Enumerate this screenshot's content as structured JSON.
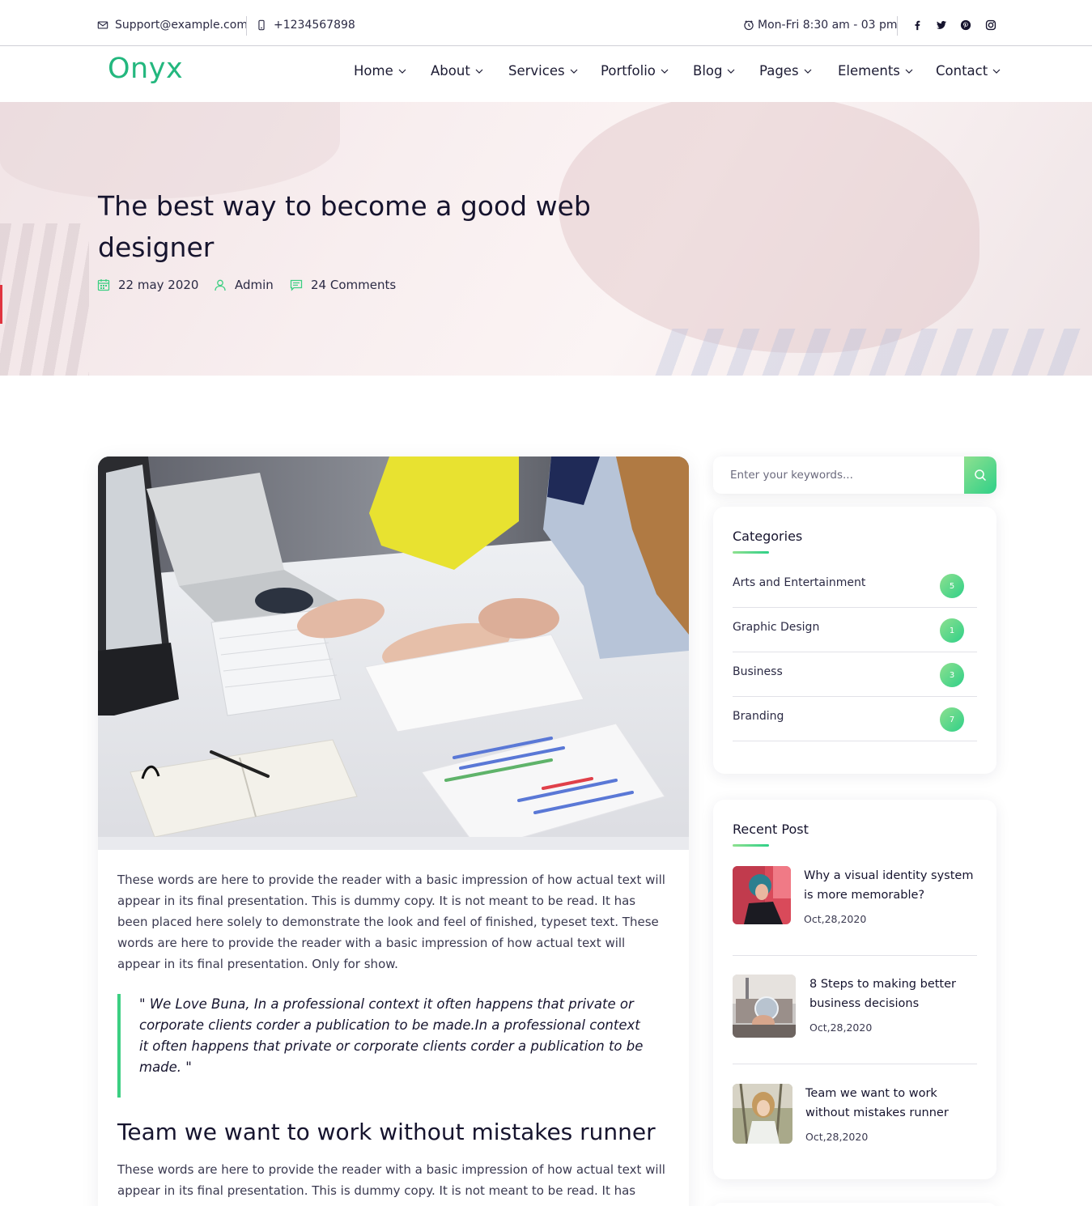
{
  "topbar": {
    "email": "Support@example.com",
    "phone": "+1234567898",
    "hours": "Mon-Fri 8:30 am - 03 pm",
    "social_icons": [
      "facebook-icon",
      "twitter-icon",
      "pinterest-icon",
      "instagram-icon"
    ]
  },
  "nav": {
    "logo": "Onyx",
    "items": [
      {
        "label": "Home"
      },
      {
        "label": "About"
      },
      {
        "label": "Services"
      },
      {
        "label": "Portfolio"
      },
      {
        "label": "Blog"
      },
      {
        "label": "Pages"
      },
      {
        "label": "Elements"
      },
      {
        "label": "Contact"
      }
    ]
  },
  "hero": {
    "title": "The best way to become a good web designer",
    "date": "22 may 2020",
    "author": "Admin",
    "comments": "24 Comments"
  },
  "article": {
    "paragraph1": "These words are here to provide the reader with a basic impression of how actual text will appear in its final presentation. This is dummy copy. It is not meant to be read. It has been placed here solely to demonstrate the look and feel of finished, typeset text. These words are here to provide the reader with a basic impression of how actual text will appear in its final presentation. Only for show.",
    "quote": "\" We Love Buna, In a professional context it often happens that private or corporate clients corder a publication to be made.In a professional context it often happens that private or corporate clients corder a publication to be made. \"",
    "heading": "Team we want to work without mistakes runner",
    "paragraph2": "These words are here to provide the reader with a basic impression of how actual text will appear in its final presentation. This is dummy copy. It is not meant to be read. It has been"
  },
  "sidebar": {
    "search_placeholder": "Enter your keywords...",
    "categories_title": "Categories",
    "categories": [
      {
        "label": "Arts and Entertainment",
        "count": "5"
      },
      {
        "label": "Graphic Design",
        "count": "1"
      },
      {
        "label": "Business",
        "count": "3"
      },
      {
        "label": "Branding",
        "count": "7"
      }
    ],
    "recent_title": "Recent Post",
    "recent": [
      {
        "title": "Why a visual identity system is more memorable?",
        "date": "Oct,28,2020"
      },
      {
        "title": "8 Steps to making better business decisions",
        "date": "Oct,28,2020"
      },
      {
        "title": "Team we want to work without mistakes runner",
        "date": "Oct,28,2020"
      }
    ]
  },
  "colors": {
    "accent": "#2fd088",
    "accent_light": "#8ee08f",
    "logo": "#23b77e",
    "heading": "#16142e"
  }
}
